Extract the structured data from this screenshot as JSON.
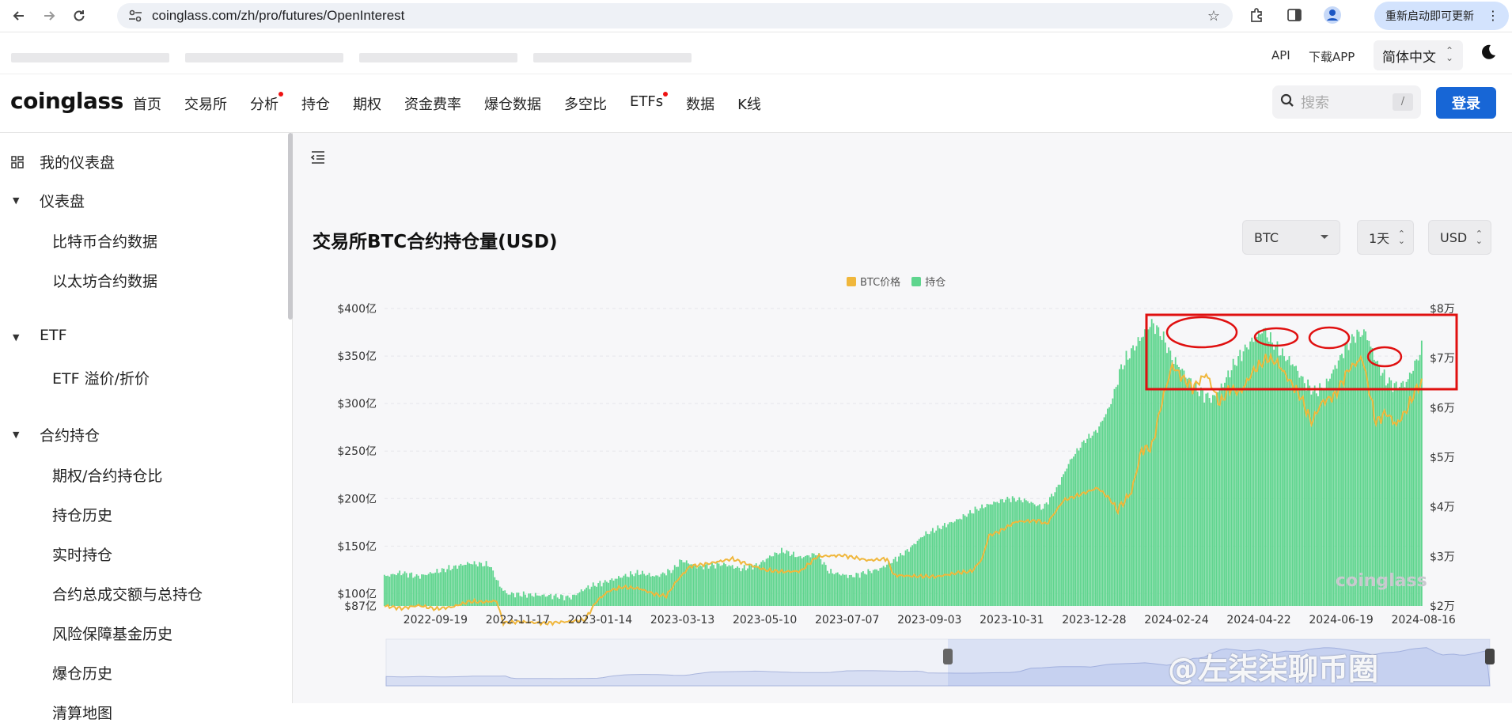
{
  "browser": {
    "url": "coinglass.com/zh/pro/futures/OpenInterest",
    "update_label": "重新启动即可更新"
  },
  "topbar": {
    "api": "API",
    "download": "下载APP",
    "language": "简体中文"
  },
  "nav": {
    "logo": "coinglass",
    "items": [
      {
        "label": "首页",
        "dot": false
      },
      {
        "label": "交易所",
        "dot": false
      },
      {
        "label": "分析",
        "dot": true
      },
      {
        "label": "持仓",
        "dot": false
      },
      {
        "label": "期权",
        "dot": false
      },
      {
        "label": "资金费率",
        "dot": false
      },
      {
        "label": "爆仓数据",
        "dot": false
      },
      {
        "label": "多空比",
        "dot": false
      },
      {
        "label": "ETFs",
        "dot": true
      },
      {
        "label": "数据",
        "dot": false
      },
      {
        "label": "K线",
        "dot": false
      }
    ],
    "search_placeholder": "搜索",
    "search_key": "/",
    "login": "登录"
  },
  "sidebar": {
    "my_dashboard": "我的仪表盘",
    "groups": [
      {
        "label": "仪表盘",
        "items": [
          "比特币合约数据",
          "以太坊合约数据"
        ]
      },
      {
        "label": "ETF",
        "items": [
          "ETF 溢价/折价"
        ]
      },
      {
        "label": "合约持仓",
        "items": [
          "期权/合约持仓比",
          "持仓历史",
          "实时持仓",
          "合约总成交额与总持仓",
          "风险保障基金历史",
          "爆仓历史",
          "清算地图"
        ]
      }
    ]
  },
  "controls": {
    "coin": "BTC",
    "interval": "1天",
    "currency": "USD"
  },
  "colors": {
    "oi_bar": "#5fd58e",
    "price_line": "#f0b73c",
    "annotation": "#e01010",
    "login": "#1766d6"
  },
  "watermark": "@左柒柒聊币圈",
  "chart_watermark": "coinglass",
  "chart_data": {
    "type": "bar",
    "title": "交易所BTC合约持仓量(USD)",
    "legend": [
      "BTC价格",
      "持仓"
    ],
    "legend_position": "top-center",
    "x_ticks": [
      "2022-09-19",
      "2022-11-17",
      "2023-01-14",
      "2023-03-13",
      "2023-05-10",
      "2023-07-07",
      "2023-09-03",
      "2023-10-31",
      "2023-12-28",
      "2024-02-24",
      "2024-04-22",
      "2024-06-19",
      "2024-08-16"
    ],
    "y_left_ticks": [
      "$87亿",
      "$100亿",
      "$150亿",
      "$200亿",
      "$250亿",
      "$300亿",
      "$350亿",
      "$400亿"
    ],
    "y_right_ticks": [
      "$2万",
      "$3万",
      "$4万",
      "$5万",
      "$6万",
      "$7万",
      "$8万"
    ],
    "y_left_range": [
      87,
      400
    ],
    "y_right_range": [
      20000,
      80000
    ],
    "grid": true,
    "series": [
      {
        "name": "持仓",
        "axis": "left",
        "type": "bar",
        "anchors": [
          [
            0,
            118
          ],
          [
            10,
            122
          ],
          [
            20,
            118
          ],
          [
            35,
            125
          ],
          [
            50,
            132
          ],
          [
            62,
            130
          ],
          [
            68,
            108
          ],
          [
            72,
            100
          ],
          [
            80,
            99
          ],
          [
            95,
            98
          ],
          [
            110,
            96
          ],
          [
            118,
            105
          ],
          [
            122,
            108
          ],
          [
            130,
            112
          ],
          [
            140,
            118
          ],
          [
            150,
            122
          ],
          [
            160,
            118
          ],
          [
            170,
            125
          ],
          [
            175,
            135
          ],
          [
            185,
            128
          ],
          [
            195,
            130
          ],
          [
            200,
            131
          ],
          [
            210,
            126
          ],
          [
            220,
            130
          ],
          [
            228,
            140
          ],
          [
            235,
            145
          ],
          [
            245,
            138
          ],
          [
            255,
            142
          ],
          [
            262,
            123
          ],
          [
            267,
            121
          ],
          [
            275,
            118
          ],
          [
            283,
            122
          ],
          [
            292,
            126
          ],
          [
            300,
            135
          ],
          [
            308,
            145
          ],
          [
            318,
            162
          ],
          [
            328,
            170
          ],
          [
            338,
            178
          ],
          [
            348,
            188
          ],
          [
            358,
            195
          ],
          [
            368,
            200
          ],
          [
            378,
            198
          ],
          [
            388,
            190
          ],
          [
            396,
            210
          ],
          [
            404,
            240
          ],
          [
            412,
            260
          ],
          [
            420,
            272
          ],
          [
            428,
            300
          ],
          [
            434,
            338
          ],
          [
            440,
            355
          ],
          [
            446,
            370
          ],
          [
            452,
            385
          ],
          [
            458,
            372
          ],
          [
            464,
            348
          ],
          [
            470,
            335
          ],
          [
            476,
            320
          ],
          [
            482,
            310
          ],
          [
            488,
            305
          ],
          [
            494,
            320
          ],
          [
            500,
            340
          ],
          [
            506,
            355
          ],
          [
            512,
            368
          ],
          [
            518,
            378
          ],
          [
            524,
            362
          ],
          [
            530,
            350
          ],
          [
            536,
            340
          ],
          [
            542,
            322
          ],
          [
            548,
            312
          ],
          [
            554,
            318
          ],
          [
            560,
            338
          ],
          [
            566,
            358
          ],
          [
            572,
            372
          ],
          [
            578,
            375
          ],
          [
            584,
            345
          ],
          [
            590,
            325
          ],
          [
            596,
            318
          ],
          [
            602,
            322
          ],
          [
            608,
            345
          ],
          [
            612,
            362
          ]
        ]
      },
      {
        "name": "BTC价格",
        "axis": "right",
        "type": "line",
        "anchors": [
          [
            0,
            20000
          ],
          [
            10,
            19500
          ],
          [
            20,
            20100
          ],
          [
            30,
            19400
          ],
          [
            40,
            19800
          ],
          [
            50,
            20900
          ],
          [
            58,
            20800
          ],
          [
            66,
            21000
          ],
          [
            70,
            16600
          ],
          [
            80,
            16800
          ],
          [
            95,
            16500
          ],
          [
            110,
            16900
          ],
          [
            118,
            17200
          ],
          [
            125,
            21000
          ],
          [
            132,
            23000
          ],
          [
            140,
            23800
          ],
          [
            150,
            23500
          ],
          [
            160,
            22300
          ],
          [
            166,
            22000
          ],
          [
            172,
            25000
          ],
          [
            180,
            28000
          ],
          [
            190,
            28500
          ],
          [
            205,
            29500
          ],
          [
            215,
            28300
          ],
          [
            225,
            27200
          ],
          [
            235,
            26900
          ],
          [
            245,
            27000
          ],
          [
            255,
            30000
          ],
          [
            270,
            30200
          ],
          [
            285,
            29200
          ],
          [
            296,
            29500
          ],
          [
            300,
            26200
          ],
          [
            312,
            26000
          ],
          [
            325,
            25900
          ],
          [
            338,
            26700
          ],
          [
            346,
            27000
          ],
          [
            352,
            29500
          ],
          [
            356,
            34200
          ],
          [
            362,
            35000
          ],
          [
            372,
            37000
          ],
          [
            385,
            37200
          ],
          [
            390,
            36500
          ],
          [
            400,
            41300
          ],
          [
            410,
            42500
          ],
          [
            420,
            43800
          ],
          [
            426,
            42000
          ],
          [
            432,
            39500
          ],
          [
            440,
            43000
          ],
          [
            446,
            51500
          ],
          [
            452,
            52000
          ],
          [
            458,
            61300
          ],
          [
            464,
            68500
          ],
          [
            470,
            66000
          ],
          [
            476,
            64000
          ],
          [
            484,
            66800
          ],
          [
            492,
            60800
          ],
          [
            498,
            64000
          ],
          [
            504,
            63000
          ],
          [
            512,
            67500
          ],
          [
            520,
            70000
          ],
          [
            526,
            69000
          ],
          [
            534,
            65000
          ],
          [
            540,
            62000
          ],
          [
            546,
            57000
          ],
          [
            552,
            61000
          ],
          [
            560,
            62500
          ],
          [
            568,
            67800
          ],
          [
            576,
            70000
          ],
          [
            584,
            57000
          ],
          [
            590,
            59000
          ],
          [
            596,
            56500
          ],
          [
            602,
            59500
          ],
          [
            608,
            64000
          ],
          [
            612,
            65000
          ]
        ]
      }
    ],
    "x_count": 612
  }
}
